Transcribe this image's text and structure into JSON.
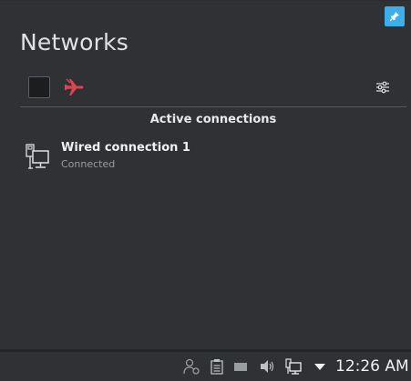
{
  "popup": {
    "title": "Networks",
    "pin_icon": "pin-icon",
    "toolbar": {
      "wifi_toggle_checked": false,
      "airplane_icon": "airplane-mode-icon",
      "airplane_color": "#da4453",
      "configure_icon": "configure-icon"
    },
    "section_heading": "Active connections",
    "connections": [
      {
        "name": "Wired connection 1",
        "status": "Connected",
        "icon": "wired-network-icon"
      }
    ]
  },
  "taskbar": {
    "tray_icons": [
      "user-switch-icon",
      "clipboard-icon",
      "battery-icon",
      "volume-icon",
      "network-wired-icon",
      "expand-tray-arrow-icon"
    ],
    "clock": "12:26 AM"
  },
  "colors": {
    "accent": "#3daee9",
    "background": "#2f3134"
  }
}
